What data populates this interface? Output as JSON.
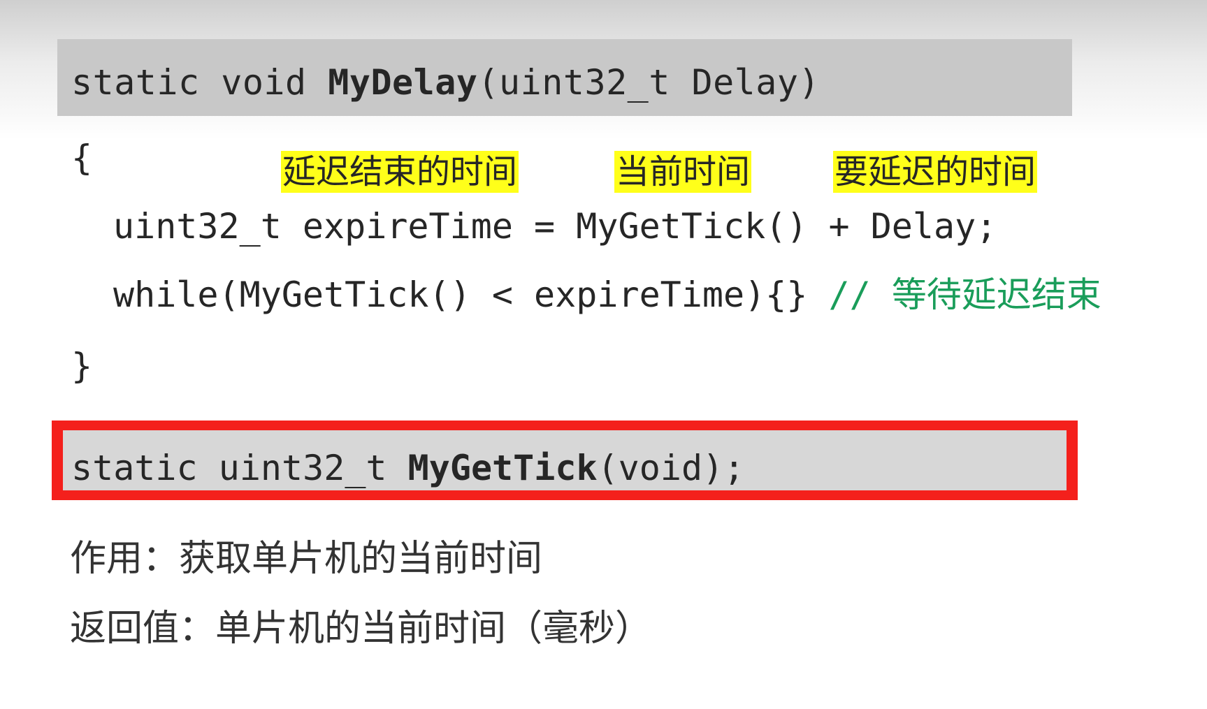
{
  "signature1": {
    "prefix": "static void ",
    "name": "MyDelay",
    "suffix": "(uint32_t Delay)"
  },
  "body": {
    "open_brace": "{",
    "close_brace": "}",
    "line1": "uint32_t expireTime = MyGetTick() + Delay;",
    "line2_code": "while(MyGetTick() < expireTime){} ",
    "line2_comment_slashes": "// ",
    "line2_comment_text": "等待延迟结束"
  },
  "annotations": {
    "expire_time": "延迟结束的时间",
    "current_time": "当前时间",
    "delay_time": "要延迟的时间"
  },
  "signature2": {
    "prefix": "static uint32_t ",
    "name": "MyGetTick",
    "suffix": "(void);"
  },
  "description": {
    "purpose": "作用：获取单片机的当前时间",
    "return_value": "返回值：单片机的当前时间（毫秒）"
  },
  "colors": {
    "highlight": "#ffff1a",
    "comment": "#1a9d5a",
    "frame": "#f4201c"
  }
}
